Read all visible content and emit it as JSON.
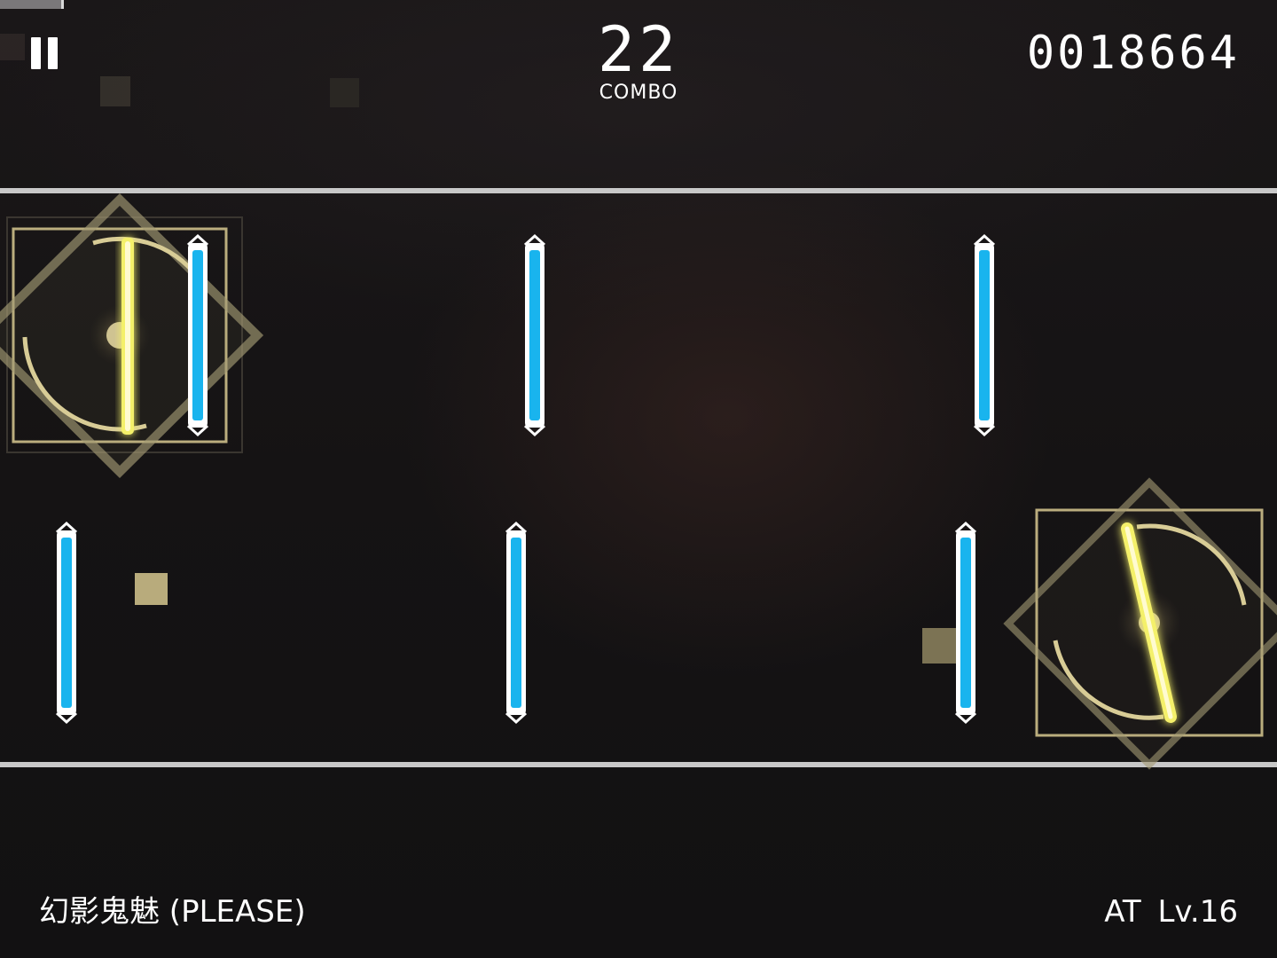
{
  "hud": {
    "combo_count": "22",
    "combo_label": "COMBO",
    "score": "0018664",
    "song_progress": 0.05,
    "pause_icon": "pause-icon"
  },
  "footer": {
    "song_title": "幻影鬼魅 (PLEASE)",
    "difficulty": "AT  Lv.16"
  },
  "colors": {
    "note_cyan": "#19b4ee",
    "judge_yellow": "#f4f06a",
    "frame_gold": "#cdbf8a",
    "judge_line": "#c8c8c8"
  },
  "notes": {
    "tap_note_count": 6,
    "judgement_count": 2
  }
}
